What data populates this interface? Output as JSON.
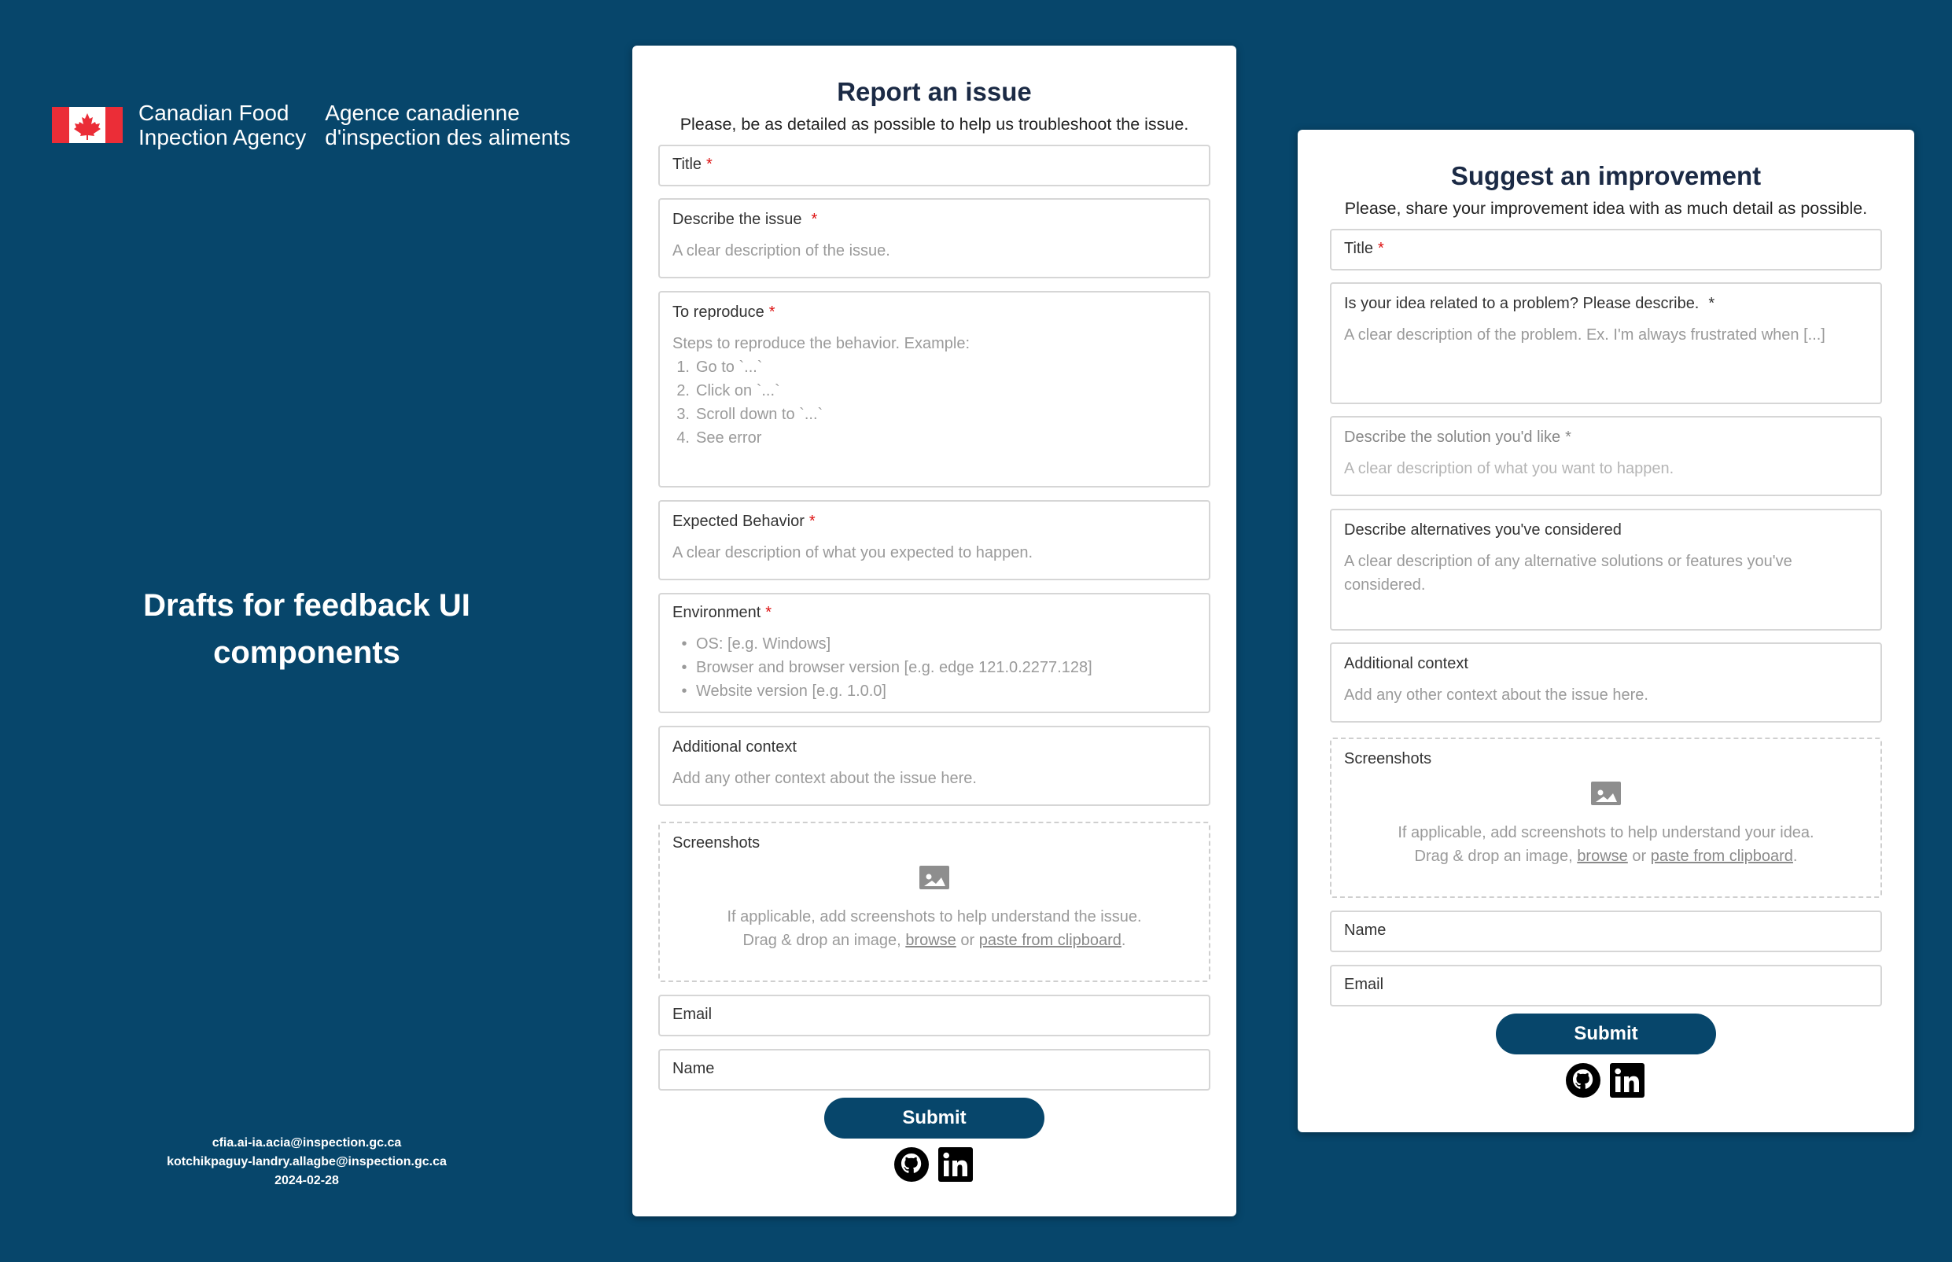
{
  "agency": {
    "en_line1": "Canadian Food",
    "en_line2": "Inpection Agency",
    "fr_line1": "Agence canadienne",
    "fr_line2": "d'inspection des aliments"
  },
  "page_heading": {
    "line1": "Drafts for feedback UI",
    "line2": "components"
  },
  "contacts": {
    "email1": "cfia.ai-ia.acia@inspection.gc.ca",
    "email2": "kotchikpaguy-landry.allagbe@inspection.gc.ca",
    "date": "2024-02-28"
  },
  "report": {
    "title": "Report an issue",
    "subtitle": "Please, be as detailed as possible to help us troubleshoot the issue.",
    "req_mark": "*",
    "fields": {
      "title_label": "Title",
      "describe_label": "Describe the issue",
      "describe_hint": "A clear description of the issue.",
      "reproduce_label": "To reproduce",
      "reproduce_intro": "Steps to reproduce the behavior. Example:",
      "reproduce_steps": [
        "1.",
        "Go to `...`",
        "2.",
        "Click on `...`",
        "3.",
        "Scroll down to `...`",
        "4.",
        "See error"
      ],
      "expected_label": "Expected Behavior",
      "expected_hint": "A clear description of what you expected to happen.",
      "environment_label": "Environment",
      "environment_items": [
        "OS: [e.g. Windows]",
        "Browser and browser version [e.g. edge 121.0.2277.128]",
        "Website version [e.g. 1.0.0]"
      ],
      "context_label": "Additional context",
      "context_hint": "Add any other context about the issue here.",
      "screenshots_label": "Screenshots",
      "screenshots_hint": "If applicable, add screenshots to help understand the issue.",
      "drag_text": "Drag & drop an image,",
      "browse": "browse",
      "or": "or",
      "paste": "paste from clipboard",
      "period": ".",
      "email_label": "Email",
      "name_label": "Name"
    },
    "submit": "Submit"
  },
  "suggest": {
    "title": "Suggest an improvement",
    "subtitle": "Please, share your improvement idea with as much detail as possible.",
    "req_mark": "*",
    "fields": {
      "title_label": "Title",
      "problem_label": "Is your idea related to a problem? Please describe.",
      "problem_hint": "A clear description of the problem. Ex. I'm always frustrated when [...]",
      "solution_label": "Describe the solution you'd like",
      "solution_hint": "A clear description of what you want to happen.",
      "alternatives_label": "Describe alternatives you've considered",
      "alternatives_hint": "A clear description of any alternative solutions or features you've considered.",
      "context_label": "Additional context",
      "context_hint": "Add any other context about the issue here.",
      "screenshots_label": "Screenshots",
      "screenshots_hint": "If applicable, add screenshots to help understand your idea.",
      "drag_text": "Drag & drop an image,",
      "browse": "browse",
      "or": "or",
      "paste": "paste from clipboard",
      "period": ".",
      "name_label": "Name",
      "email_label": "Email"
    },
    "submit": "Submit"
  },
  "icons": {
    "flag": "canada-flag-icon",
    "image": "image-icon",
    "github": "github-icon",
    "linkedin": "linkedin-icon"
  },
  "colors": {
    "background": "#07466b",
    "button": "#07466b",
    "required": "#dd1111",
    "flag_red": "#eb2d37"
  }
}
